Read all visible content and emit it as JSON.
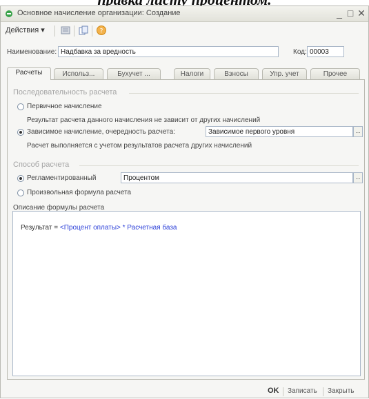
{
  "caption": "правка листу процентом.",
  "window": {
    "title": "Основное начисление организации: Создание",
    "minimize": "_",
    "maximize": "□",
    "close": "✕"
  },
  "toolbar": {
    "actions_label": "Действия ▾"
  },
  "form": {
    "name_label": "Наименование:",
    "name_value": "Надбавка за вредность",
    "code_label": "Код:",
    "code_value": "00003"
  },
  "tabs": [
    "Расчеты",
    "Использ...",
    "Бухучет ...",
    "Налоги",
    "Взносы",
    "Упр. учет",
    "Прочее"
  ],
  "calc_sequence": {
    "section_title": "Последовательность расчета",
    "primary_label": "Первичное начисление",
    "primary_desc": "Результат расчета данного начисления не зависит от других начислений",
    "dependent_label": "Зависимое начисление, очередность расчета:",
    "dependent_value": "Зависимое первого уровня",
    "dependent_desc": "Расчет выполняется с учетом результатов расчета других начислений",
    "selected": "dependent"
  },
  "calc_method": {
    "section_title": "Способ расчета",
    "regulated_label": "Регламентированный",
    "regulated_value": "Процентом",
    "arbitrary_label": "Произвольная формула расчета",
    "selected": "regulated"
  },
  "formula": {
    "label": "Описание формулы расчета",
    "prefix": "Результат = ",
    "term1": "<Процент оплаты>",
    "op": " * ",
    "term2": "Расчетная база"
  },
  "buttons": {
    "ellipsis": "...",
    "ok": "OK",
    "save": "Записать",
    "close": "Закрыть"
  }
}
